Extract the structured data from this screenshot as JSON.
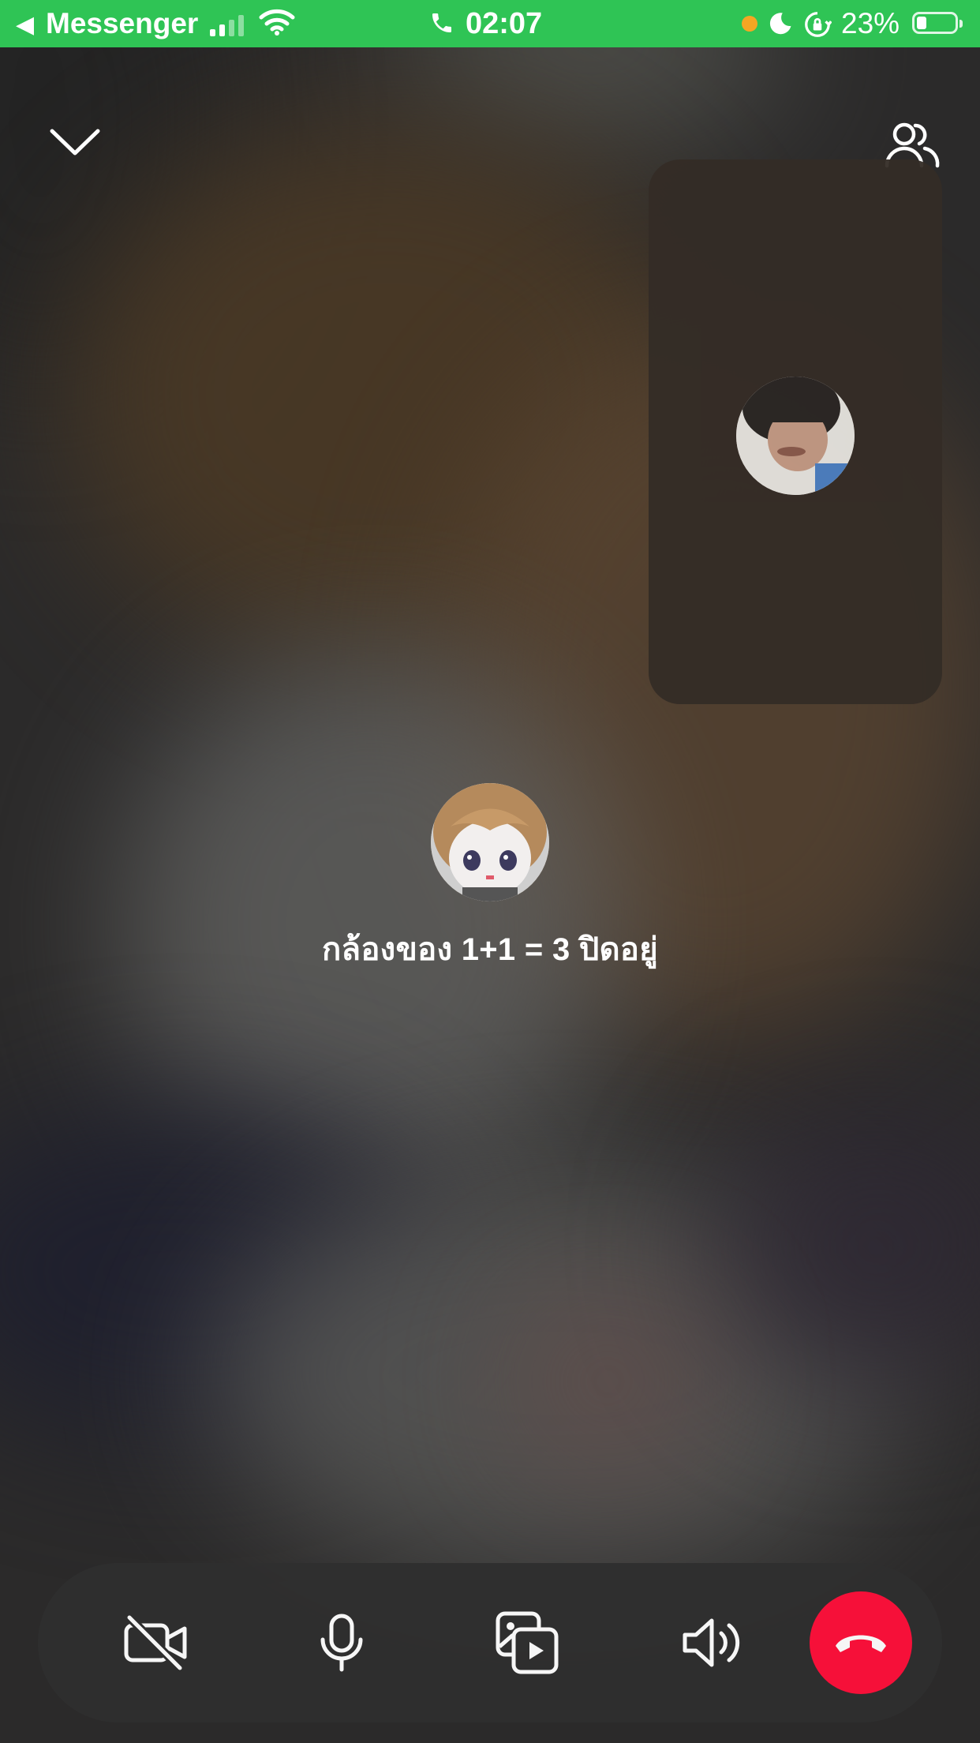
{
  "status_bar": {
    "back_app": "Messenger",
    "time": "02:07",
    "battery": "23%"
  },
  "call": {
    "camera_off_message": "กล้องของ 1+1 = 3 ปิดอยู่"
  },
  "icons": {
    "minimize": "chevron-down-icon",
    "participants": "people-icon",
    "camera": "video-off-icon",
    "microphone": "microphone-icon",
    "media": "media-share-icon",
    "speaker": "speaker-icon",
    "end_call": "end-call-icon"
  },
  "colors": {
    "status_bar": "#2fc455",
    "end_call": "#ff0f3a",
    "privacy_dot": "#f5a623"
  }
}
